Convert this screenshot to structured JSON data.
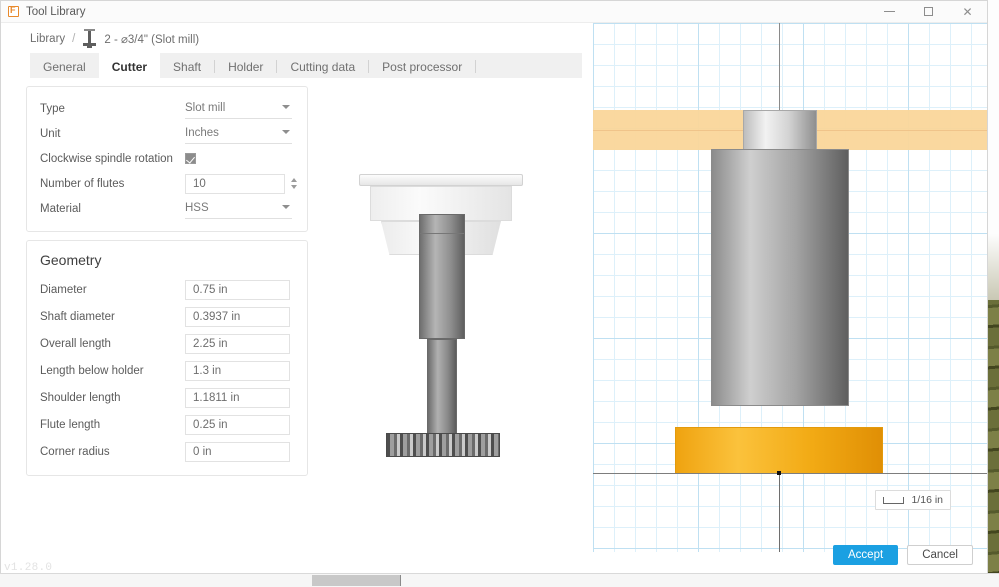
{
  "window": {
    "title": "Tool Library",
    "app_icon": "fusion-f-icon",
    "controls": {
      "minimize": "minimize-icon",
      "maximize": "maximize-icon",
      "close": "close-icon"
    }
  },
  "breadcrumb": {
    "root": "Library",
    "separator": "/",
    "tool_icon": "slot-mill-icon",
    "current": "2 - ⌀3/4\" (Slot mill)"
  },
  "tabs": [
    {
      "label": "General",
      "active": false
    },
    {
      "label": "Cutter",
      "active": true
    },
    {
      "label": "Shaft",
      "active": false
    },
    {
      "label": "Holder",
      "active": false
    },
    {
      "label": "Cutting data",
      "active": false
    },
    {
      "label": "Post processor",
      "active": false
    }
  ],
  "cutter": {
    "type": {
      "label": "Type",
      "value": "Slot mill"
    },
    "unit": {
      "label": "Unit",
      "value": "Inches"
    },
    "rotation": {
      "label": "Clockwise spindle rotation",
      "checked": true
    },
    "flutes": {
      "label": "Number of flutes",
      "value": "10"
    },
    "material": {
      "label": "Material",
      "value": "HSS"
    }
  },
  "geometry": {
    "title": "Geometry",
    "fields": [
      {
        "label": "Diameter",
        "value": "0.75 in"
      },
      {
        "label": "Shaft diameter",
        "value": "0.3937 in"
      },
      {
        "label": "Overall length",
        "value": "2.25 in"
      },
      {
        "label": "Length below holder",
        "value": "1.3 in"
      },
      {
        "label": "Shoulder length",
        "value": "1.1811 in"
      },
      {
        "label": "Flute length",
        "value": "0.25 in"
      },
      {
        "label": "Corner radius",
        "value": "0 in"
      }
    ]
  },
  "viewport": {
    "scale_label": "1/16 in",
    "scale_glyph": "scale-bracket-icon",
    "grid_color": "#ddf0fa",
    "grid_major_color": "#bfe0f2",
    "holder_band_color": "#fad69a",
    "cutter_color": "#f2aa14",
    "shaft_color": "#a3a3a3"
  },
  "footer": {
    "accept": "Accept",
    "cancel": "Cancel",
    "accent": "#1ba0e2"
  },
  "status": {
    "version": "v1.28.0"
  }
}
